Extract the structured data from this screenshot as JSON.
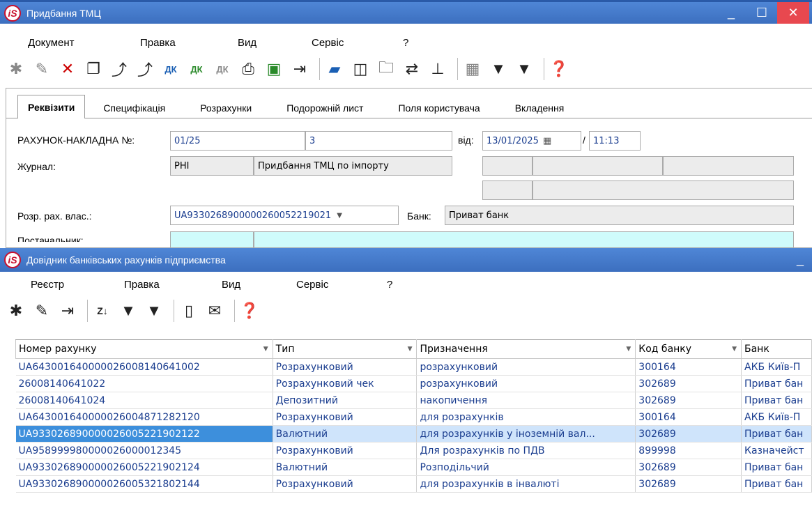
{
  "window1": {
    "title": "Придбання ТМЦ",
    "logo": "iS",
    "menu": [
      "Документ",
      "Правка",
      "Вид",
      "Сервіс",
      "?"
    ],
    "tabs": [
      "Реквізити",
      "Специфікація",
      "Розрахунки",
      "Подорожній лист",
      "Поля користувача",
      "Вкладення"
    ],
    "form": {
      "invoice_label": "РАХУНОК-НАКЛАДНА №:",
      "invoice_no": "01/25",
      "invoice_suffix": "3",
      "date_label": "від:",
      "date": "13/01/2025",
      "time_sep": "/",
      "time": "11:13",
      "journal_label": "Журнал:",
      "journal_code": "PHI",
      "journal_name": "Придбання ТМЦ по імпорту",
      "account_label": "Розр. рах. влас.:",
      "account": "UA933026890000026005221902​1",
      "bank_label": "Банк:",
      "bank": "Приват банк",
      "supplier_label": "Постачальник:"
    }
  },
  "window2": {
    "title": "Довідник банківських рахунків підприємства",
    "logo": "iS",
    "menu": [
      "Реєстр",
      "Правка",
      "Вид",
      "Сервіс",
      "?"
    ],
    "columns": [
      "Номер рахунку",
      "Тип",
      "Призначення",
      "Код банку",
      "Банк"
    ],
    "rows": [
      [
        "UA643001640000026008140641002",
        "Розрахунковий",
        "розрахунковий",
        "300164",
        "АКБ Київ-П"
      ],
      [
        "26008140641022",
        "Розрахунковий чек",
        "розрахунковий",
        "302689",
        "Приват бан"
      ],
      [
        "26008140641024",
        "Депозитний",
        "накопичення",
        "302689",
        "Приват бан"
      ],
      [
        "UA643001640000026004871282120",
        "Розрахунковий",
        "для розрахунків",
        "300164",
        "АКБ Київ-П"
      ],
      [
        "UA933026890000026005221902122",
        "Валютний",
        "для розрахунків у іноземній вал...",
        "302689",
        "Приват бан"
      ],
      [
        "UA958999980000026000012345",
        "Розрахунковий",
        "Для розрахунків по ПДВ",
        "899998",
        "Казначейст"
      ],
      [
        "UA933026890000026005221902124",
        "Валютний",
        "Розподільчий",
        "302689",
        "Приват бан"
      ],
      [
        "UA933026890000026005321802144",
        "Розрахунковий",
        "для розрахунків в інвалюті",
        "302689",
        "Приват бан"
      ]
    ],
    "selected_row": 4
  }
}
